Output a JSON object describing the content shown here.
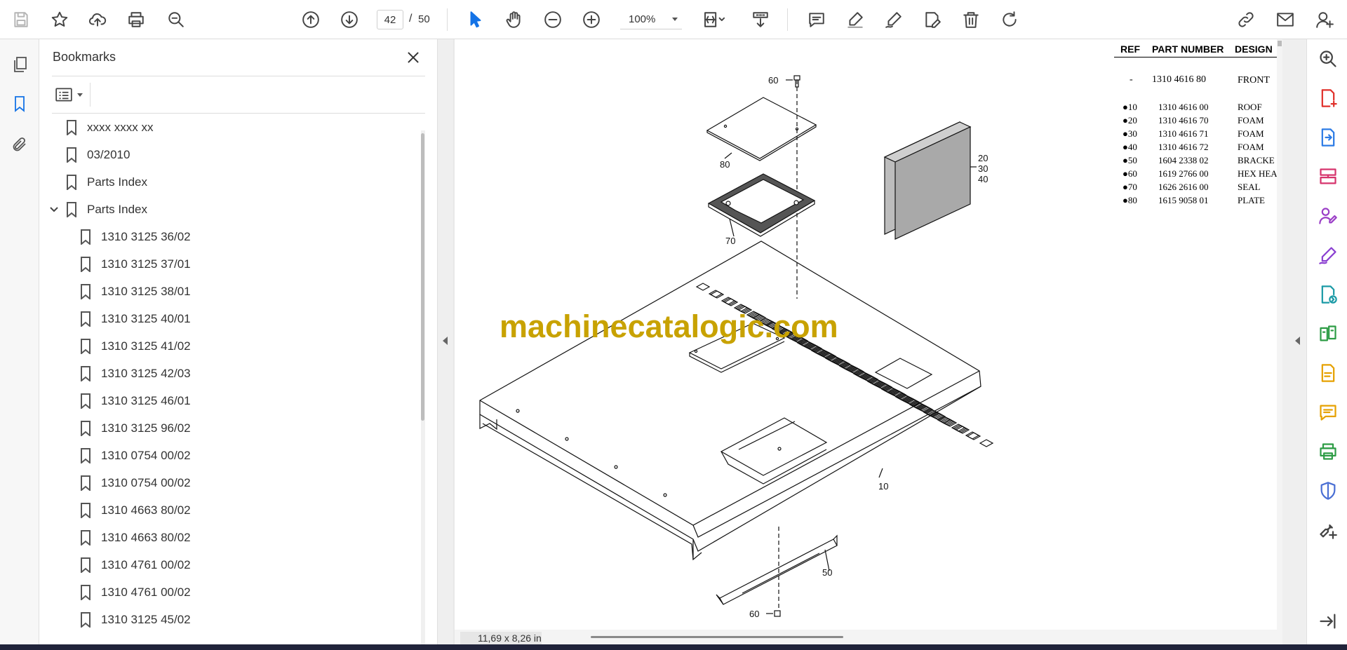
{
  "toolbar": {
    "page_current": "42",
    "page_separator": "/",
    "page_total": "50",
    "zoom": "100%",
    "icons": [
      "save-icon",
      "star-icon",
      "upload-icon",
      "print-icon",
      "find-icon",
      "previous-page-icon",
      "next-page-icon",
      "select-tool-icon",
      "hand-tool-icon",
      "zoom-out-icon",
      "zoom-in-icon",
      "fit-page-icon",
      "scroll-mode-icon",
      "comment-icon",
      "highlight-icon",
      "draw-icon",
      "edit-text-icon",
      "delete-icon",
      "rotate-icon",
      "share-link-icon",
      "email-icon",
      "account-icon"
    ]
  },
  "left_rail": {
    "icons": [
      "pages-icon",
      "bookmarks-icon",
      "attachments-icon"
    ]
  },
  "bookmarks": {
    "title": "Bookmarks",
    "items": [
      {
        "label": "xxxx xxxx xx",
        "level": 0
      },
      {
        "label": "03/2010",
        "level": 0
      },
      {
        "label": "Parts Index",
        "level": 0
      },
      {
        "label": "Parts Index",
        "level": 0,
        "expanded": true
      },
      {
        "label": "1310 3125 36/02",
        "level": 1
      },
      {
        "label": "1310 3125 37/01",
        "level": 1
      },
      {
        "label": "1310 3125 38/01",
        "level": 1
      },
      {
        "label": "1310 3125 40/01",
        "level": 1
      },
      {
        "label": "1310 3125 41/02",
        "level": 1
      },
      {
        "label": "1310 3125 42/03",
        "level": 1
      },
      {
        "label": "1310 3125 46/01",
        "level": 1
      },
      {
        "label": "1310 3125 96/02",
        "level": 1
      },
      {
        "label": "1310 0754 00/02",
        "level": 1
      },
      {
        "label": "1310 0754 00/02",
        "level": 1
      },
      {
        "label": "1310 4663 80/02",
        "level": 1
      },
      {
        "label": "1310 4663 80/02",
        "level": 1
      },
      {
        "label": "1310 4761 00/02",
        "level": 1
      },
      {
        "label": "1310 4761 00/02",
        "level": 1
      },
      {
        "label": "1310 3125 45/02",
        "level": 1
      }
    ]
  },
  "document": {
    "watermark": "machinecatalogic.com",
    "page_size": "11,69 x 8,26 in",
    "callouts": {
      "c60_top": "60",
      "c80": "80",
      "c70": "70",
      "c20": "20",
      "c30": "30",
      "c40": "40",
      "c10": "10",
      "c50": "50",
      "c60_bottom": "60"
    },
    "parts_table": {
      "headers": {
        "ref": "REF",
        "part_number": "PART NUMBER",
        "designation": "DESIGN"
      },
      "rows": [
        {
          "ref": "-",
          "part": "1310 4616 80",
          "desc": "FRONT"
        },
        {
          "ref": "●10",
          "part": "1310 4616 00",
          "desc": "ROOF"
        },
        {
          "ref": "●20",
          "part": "1310 4616 70",
          "desc": "FOAM"
        },
        {
          "ref": "●30",
          "part": "1310 4616 71",
          "desc": "FOAM"
        },
        {
          "ref": "●40",
          "part": "1310 4616 72",
          "desc": "FOAM"
        },
        {
          "ref": "●50",
          "part": "1604 2338 02",
          "desc": "BRACKE"
        },
        {
          "ref": "●60",
          "part": "1619 2766 00",
          "desc": "HEX HEA"
        },
        {
          "ref": "●70",
          "part": "1626 2616 00",
          "desc": "SEAL"
        },
        {
          "ref": "●80",
          "part": "1615 9058 01",
          "desc": "PLATE"
        }
      ]
    }
  },
  "right_rail": {
    "icons": [
      {
        "name": "search-zoom-icon",
        "color": "#444444"
      },
      {
        "name": "create-pdf-icon",
        "color": "#e0312b"
      },
      {
        "name": "export-pdf-icon",
        "color": "#2c7be5"
      },
      {
        "name": "organize-pages-icon",
        "color": "#d6336c"
      },
      {
        "name": "request-signature-icon",
        "color": "#9b3fc7"
      },
      {
        "name": "fill-sign-icon",
        "color": "#8a3fd1"
      },
      {
        "name": "send-review-icon",
        "color": "#1b9aa6"
      },
      {
        "name": "compare-icon",
        "color": "#2d9c45"
      },
      {
        "name": "edit-pdf-icon",
        "color": "#e6a100"
      },
      {
        "name": "comment-tool-icon",
        "color": "#e6a100"
      },
      {
        "name": "print-production-icon",
        "color": "#2d9c45"
      },
      {
        "name": "protect-icon",
        "color": "#4a6fd4"
      },
      {
        "name": "more-tools-icon",
        "color": "#444444"
      },
      {
        "name": "collapse-panel-icon",
        "color": "#444444"
      }
    ]
  }
}
